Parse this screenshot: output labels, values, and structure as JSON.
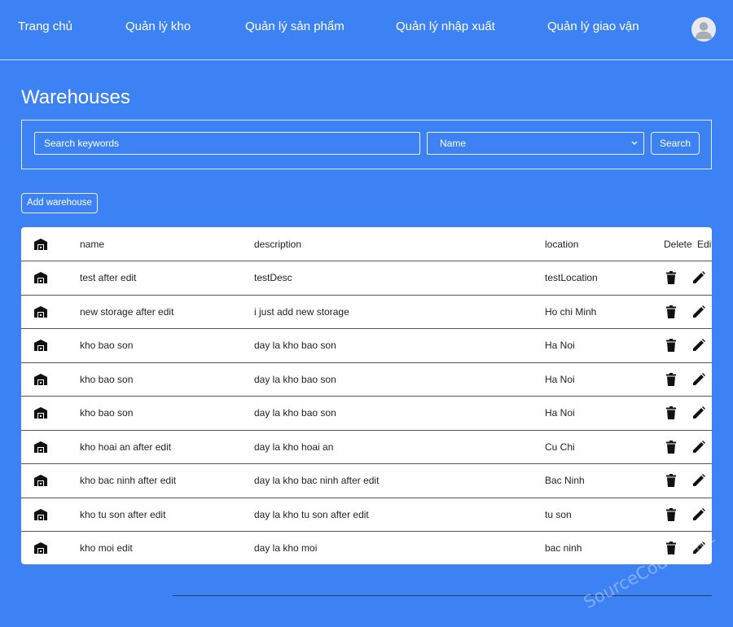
{
  "nav": {
    "items": [
      {
        "label": "Trang chủ"
      },
      {
        "label": "Quản lý kho"
      },
      {
        "label": "Quản lý sản phẩm"
      },
      {
        "label": "Quản lý nhập xuất"
      },
      {
        "label": "Quản lý giao vận"
      }
    ]
  },
  "page": {
    "title": "Warehouses"
  },
  "search": {
    "placeholder": "Search keywords",
    "value": "",
    "select_value": "Name",
    "button_label": "Search"
  },
  "add_button_label": "Add warehouse",
  "table": {
    "headers": {
      "name": "name",
      "description": "description",
      "location": "location",
      "delete": "Delete",
      "edit": "Edit"
    },
    "rows": [
      {
        "name": "test after edit",
        "description": "testDesc",
        "location": "testLocation"
      },
      {
        "name": "new storage after edit",
        "description": "i just add new storage",
        "location": "Ho chi Minh"
      },
      {
        "name": "kho bao son",
        "description": "day la kho bao son",
        "location": "Ha Noi"
      },
      {
        "name": "kho bao son",
        "description": "day la kho bao son",
        "location": "Ha Noi"
      },
      {
        "name": "kho bao son",
        "description": "day la kho bao son",
        "location": "Ha Noi"
      },
      {
        "name": "kho hoai an after edit",
        "description": "day la kho hoai an",
        "location": "Cu Chi"
      },
      {
        "name": "kho bac ninh after edit",
        "description": "day la kho bac ninh after edit",
        "location": "Bac Ninh"
      },
      {
        "name": "kho tu son after edit",
        "description": "day la kho tu son after edit",
        "location": "tu son"
      },
      {
        "name": "kho moi edit",
        "description": "day la kho moi",
        "location": "bac ninh"
      }
    ]
  },
  "watermark": "SourceCodes.net",
  "icons": {
    "row_icon": "warehouse-icon",
    "delete": "trash-icon",
    "edit": "pencil-icon",
    "avatar": "user-avatar-icon"
  },
  "colors": {
    "background": "#3d82f5",
    "card": "#ffffff",
    "text": "#222222"
  }
}
